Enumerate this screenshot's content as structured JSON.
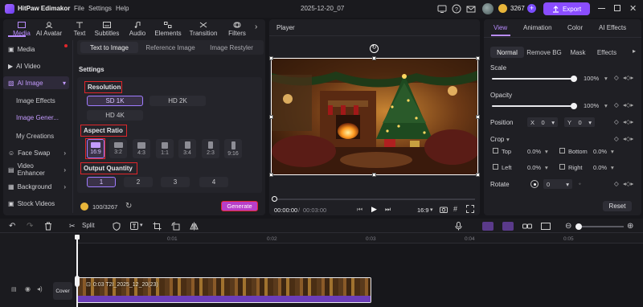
{
  "app": {
    "name": "HitPaw Edimakor",
    "menu": [
      "File",
      "Settings",
      "Help"
    ],
    "project_name": "2025-12-20_07",
    "credits": "3267",
    "export_label": "Export"
  },
  "left_tabs": [
    "Media",
    "AI Avatar",
    "Text",
    "Subtitles",
    "Audio",
    "Elements",
    "Transition",
    "Filters"
  ],
  "sidebar": {
    "items": [
      "Media",
      "AI Video",
      "AI Image",
      "Face Swap",
      "Video Enhancer",
      "Background",
      "Stock Videos"
    ],
    "ai_image_sub": [
      "Image Effects",
      "Image Gener...",
      "My Creations"
    ]
  },
  "ai_image": {
    "subtabs": [
      "Text to Image",
      "Reference Image",
      "Image Restyler"
    ],
    "settings_label": "Settings",
    "resolution_label": "Resolution",
    "resolutions": [
      "SD 1K",
      "HD 2K",
      "HD 4K"
    ],
    "aspect_label": "Aspect Ratio",
    "aspects": [
      "16:9",
      "3:2",
      "4:3",
      "1:1",
      "3:4",
      "2:3",
      "9:16"
    ],
    "quantity_label": "Output Quantity",
    "quantities": [
      "1",
      "2",
      "3",
      "4"
    ],
    "usage": "100/3267",
    "generate_label": "Generate"
  },
  "player": {
    "title": "Player",
    "time_current": "00:00:00",
    "time_total": "00:03:00",
    "ratio": "16:9"
  },
  "right_panel": {
    "tabs": [
      "View",
      "Animation",
      "Color",
      "AI Effects"
    ],
    "subtabs": [
      "Normal",
      "Remove BG",
      "Mask",
      "Effects"
    ],
    "scale_label": "Scale",
    "scale_value": "100%",
    "scale_level": 1.0,
    "opacity_label": "Opacity",
    "opacity_value": "100%",
    "opacity_level": 1.0,
    "position_label": "Position",
    "pos_x_label": "X",
    "pos_x": "0",
    "pos_y_label": "Y",
    "pos_y": "0",
    "crop_label": "Crop",
    "crop_top_label": "Top",
    "crop_top": "0.0%",
    "crop_bottom_label": "Bottom",
    "crop_bottom": "0.0%",
    "crop_left_label": "Left",
    "crop_left": "0.0%",
    "crop_right_label": "Right",
    "crop_right": "0.0%",
    "rotate_label": "Rotate",
    "rotate_value": "0",
    "reset_label": "Reset"
  },
  "timeline": {
    "split_label": "Split",
    "ruler": [
      "0:01",
      "0:02",
      "0:03",
      "0:04",
      "0:05"
    ],
    "cover_label": "Cover",
    "clip_label": "0:03 T2I_2025_12_20(23)"
  }
}
